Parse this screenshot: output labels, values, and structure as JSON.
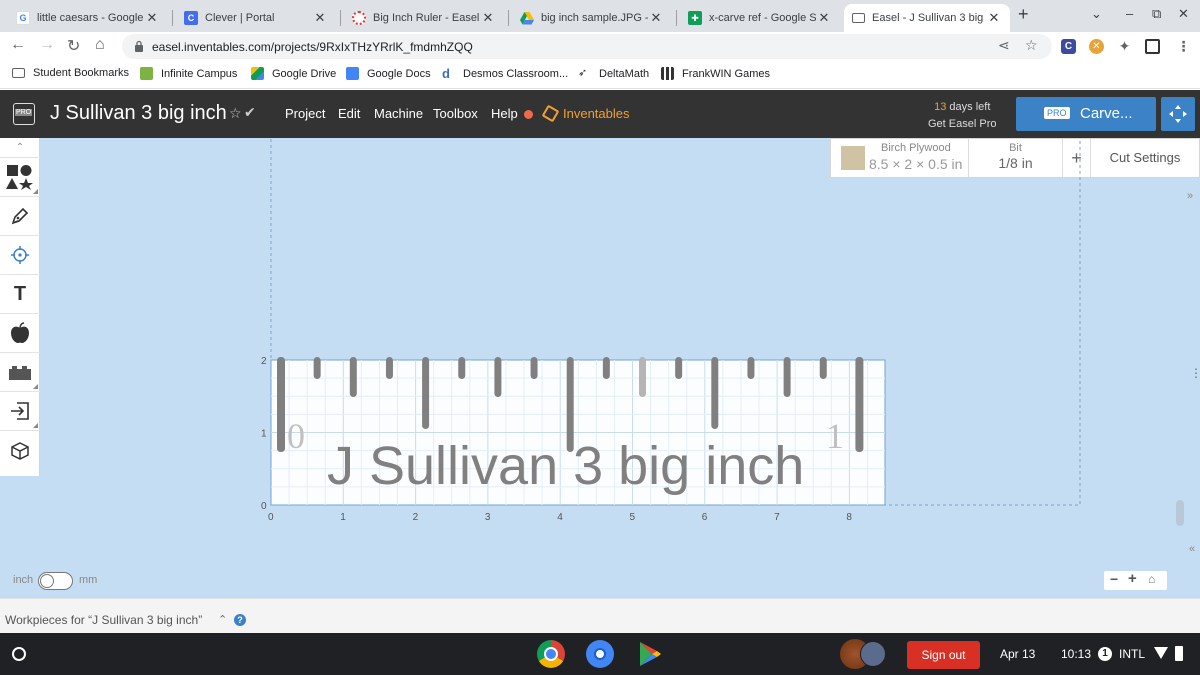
{
  "tabs": [
    {
      "title": "little caesars - Google S",
      "favicon": "google-icon",
      "color": "#4285f4"
    },
    {
      "title": "Clever | Portal",
      "favicon": "clever-icon",
      "color": "#436cf2"
    },
    {
      "title": "Big Inch Ruler - Easel",
      "favicon": "easel-icon",
      "color": "#e53935"
    },
    {
      "title": "big inch sample.JPG - G",
      "favicon": "google-drive-icon",
      "color": "#fbbc04"
    },
    {
      "title": "x-carve ref - Google She",
      "favicon": "google-sheets-icon",
      "color": "#0f9d58"
    },
    {
      "title": "Easel - J Sullivan 3 big",
      "favicon": "easel-tab-icon",
      "color": "#5f6368"
    }
  ],
  "url": "easel.inventables.com/projects/9RxIxTHzYRrlK_fmdmhZQQ",
  "bookmarks": [
    "Student Bookmarks",
    "Infinite Campus",
    "Google Drive",
    "Google Docs",
    "Desmos Classroom...",
    "DeltaMath",
    "FrankWIN Games"
  ],
  "app": {
    "pro_badge": "PRO",
    "project_name": "J Sullivan 3 big inch",
    "menu": [
      "Project",
      "Edit",
      "Machine",
      "Toolbox",
      "Help"
    ],
    "inventables": "Inventables",
    "trial_days": "13",
    "trial_suffix": "days left",
    "trial_cta": "Get Easel Pro",
    "carve_badge": "PRO",
    "carve_label": "Carve...",
    "accent": "#3c82c6",
    "brand_orange": "#f0a030"
  },
  "material": {
    "name": "Birch Plywood",
    "dims": "8.5 × 2 × 0.5 in",
    "bit_label": "Bit",
    "bit_value": "1/8 in",
    "plus": "+",
    "cut_settings": "Cut Settings"
  },
  "ruler": {
    "text": "J Sullivan 3 big inch",
    "zero": "0",
    "one": "1",
    "y_ticks": [
      "2",
      "1",
      "0"
    ],
    "x_ticks": [
      "0",
      "1",
      "2",
      "3",
      "4",
      "5",
      "6",
      "7",
      "8"
    ],
    "mark_color": "#808080"
  },
  "units": {
    "left": "inch",
    "right": "mm"
  },
  "workpieces_label": "Workpieces for “J Sullivan 3 big inch”",
  "zoom": {
    "minus": "−",
    "plus": "+"
  },
  "shelf": {
    "sign_out": "Sign out",
    "date": "Apr 13",
    "time": "10:13",
    "badge": "1",
    "keyboard": "INTL"
  }
}
